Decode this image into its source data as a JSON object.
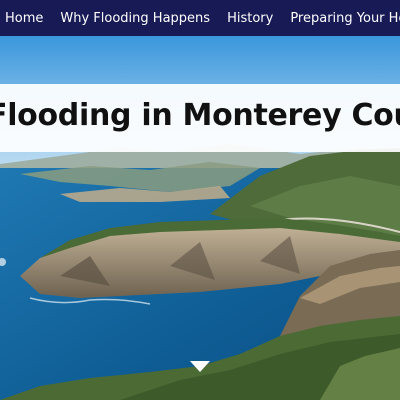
{
  "nav": {
    "items": [
      {
        "label": "Home"
      },
      {
        "label": "Why Flooding Happens"
      },
      {
        "label": "History"
      },
      {
        "label": "Preparing Your Home"
      }
    ]
  },
  "hero": {
    "title": "Flooding in Monterey County",
    "scroll_icon": "chevron-down-icon"
  },
  "colors": {
    "nav_bg": "#171a55",
    "nav_text": "#ffffff",
    "title_band": "#ffffff",
    "title_text": "#111111"
  }
}
